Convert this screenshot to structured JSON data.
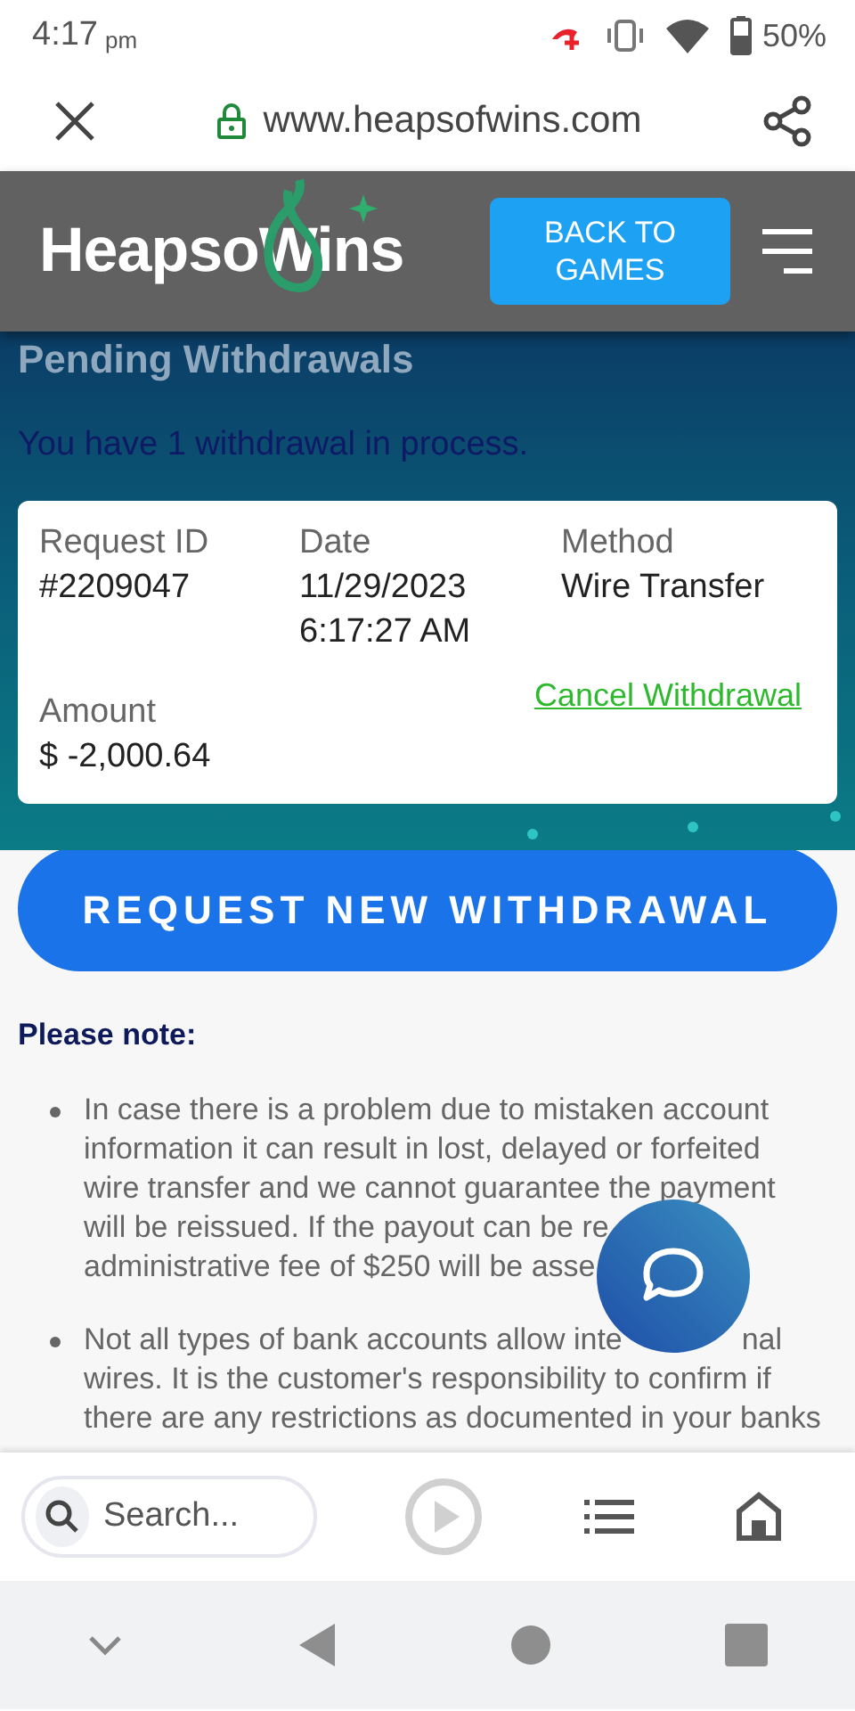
{
  "status_bar": {
    "time": "4:17",
    "period": "pm",
    "battery": "50%"
  },
  "browser": {
    "url": "www.heapsofwins.com"
  },
  "site_header": {
    "logo": "HeapsoWins",
    "back_button": "BACK TO GAMES"
  },
  "pending": {
    "title": "Pending Withdrawals",
    "summary": "You have 1 withdrawal in process.",
    "withdrawal": {
      "fields": [
        {
          "label": "Request ID",
          "value": "#2209047"
        },
        {
          "label": "Date",
          "value": "11/29/2023 6:17:27 AM"
        },
        {
          "label": "Method",
          "value": "Wire Transfer"
        }
      ],
      "amount_label": "Amount",
      "amount": "$ -2,000.64",
      "cancel_link": "Cancel Withdrawal"
    }
  },
  "request_button": "REQUEST NEW WITHDRAWAL",
  "notes": {
    "title": "Please note:",
    "bullets": [
      {
        "lines": [
          [
            "In case there is a problem due to mistaken account"
          ],
          [
            "information it can result in lost, delayed or forfeited"
          ],
          [
            "wire transfer and we cannot guarantee the payment"
          ],
          [
            "will be reissued. If the payout can be re"
          ],
          [
            "administrative fee of $250 will be asse"
          ]
        ]
      },
      {
        "lines": [
          [
            "Not all types of bank accounts allow inte",
            "nal"
          ],
          [
            "wires. It is the customer's responsibility to confirm if"
          ],
          [
            "there are any restrictions as documented in your banks"
          ]
        ]
      }
    ]
  },
  "bottom_bar": {
    "search_placeholder": "Search..."
  }
}
